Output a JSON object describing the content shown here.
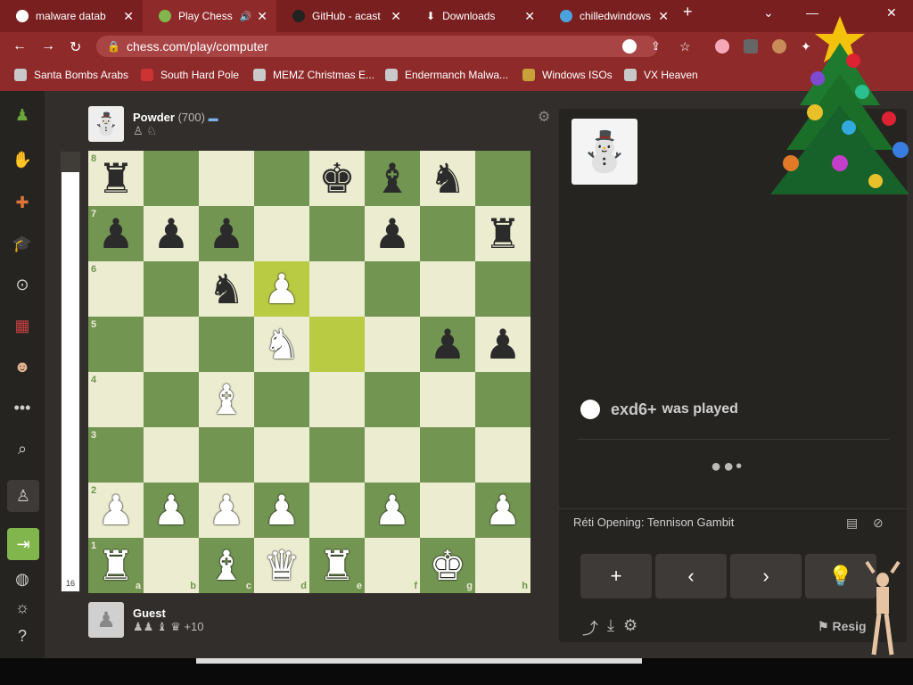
{
  "browser": {
    "tabs": [
      {
        "title": "malware datab",
        "active": false
      },
      {
        "title": "Play Chess",
        "active": true
      },
      {
        "title": "GitHub - acast",
        "active": false
      },
      {
        "title": "Downloads",
        "active": false
      },
      {
        "title": "chilledwindows",
        "active": false
      }
    ],
    "new_tab": "+",
    "url": "chess.com/play/computer",
    "bookmarks": [
      "Santa Bombs Arabs",
      "South Hard Pole",
      "MEMZ Christmas E...",
      "Endermanch Malwa...",
      "Windows ISOs",
      "VX Heaven"
    ]
  },
  "game": {
    "opponent": {
      "name": "Powder",
      "rating": "(700)"
    },
    "player": {
      "name": "Guest",
      "material": "+10"
    },
    "eval": "16",
    "board": [
      [
        "br",
        "",
        "",
        "",
        "bk",
        "bb",
        "bn",
        ""
      ],
      [
        "bp",
        "bp",
        "bp",
        "",
        "",
        "bp",
        "",
        "br"
      ],
      [
        "",
        "",
        "bn",
        "wp",
        "",
        "",
        "",
        ""
      ],
      [
        "",
        "",
        "",
        "wn",
        "",
        "",
        "bp",
        "bp"
      ],
      [
        "",
        "",
        "wb",
        "",
        "",
        "",
        "",
        ""
      ],
      [
        "",
        "",
        "",
        "",
        "",
        "",
        "",
        ""
      ],
      [
        "wp",
        "wp",
        "wp",
        "wp",
        "",
        "wp",
        "",
        "wp"
      ],
      [
        "wr",
        "",
        "wb",
        "wq",
        "wr",
        "",
        "wk",
        ""
      ]
    ],
    "highlight": [
      "d6",
      "e5"
    ],
    "ranks": [
      "8",
      "7",
      "6",
      "5",
      "4",
      "3",
      "2",
      "1"
    ],
    "files": [
      "a",
      "b",
      "c",
      "d",
      "e",
      "f",
      "g",
      "h"
    ],
    "last_move": {
      "san": "exd6+",
      "text": "was played"
    },
    "opening": "Réti Opening: Tennison Gambit",
    "resign": "Resig"
  },
  "colors": {
    "light_square": "#ebecd0",
    "dark_square": "#739552",
    "highlight_light": "#f5f682",
    "highlight_dark": "#b9ca43"
  }
}
